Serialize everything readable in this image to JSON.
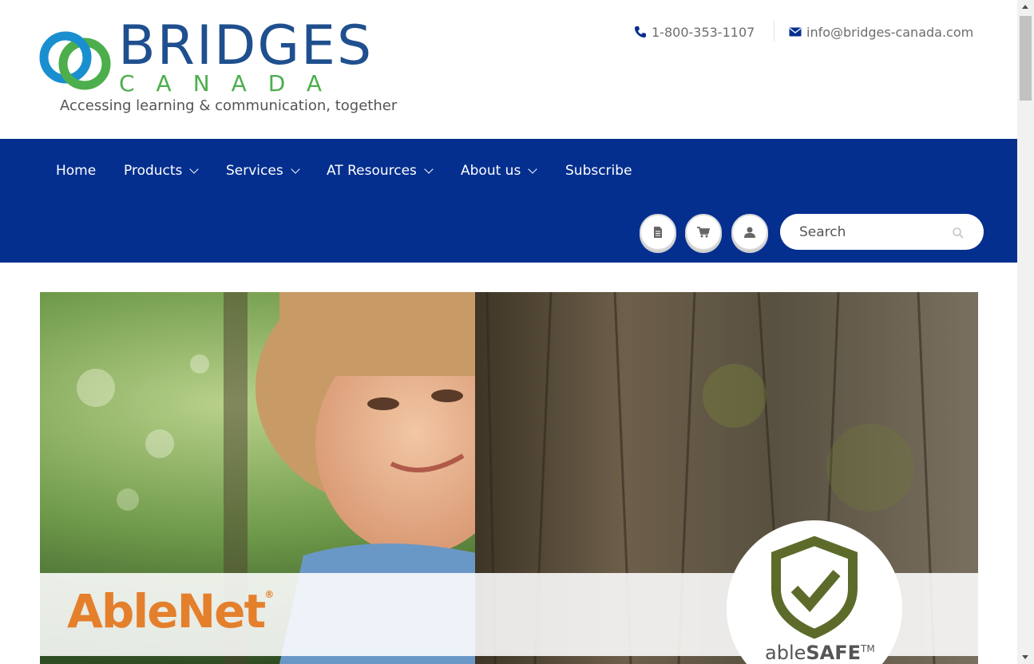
{
  "header": {
    "logo": {
      "brand": "BRIDGES",
      "sub": "CANADA",
      "tagline": "Accessing learning & communication, together",
      "colors": {
        "blue": "#1f4f8e",
        "green": "#4cae4c"
      }
    },
    "phone": {
      "icon": "phone-icon",
      "text": "1-800-353-1107"
    },
    "email": {
      "icon": "envelope-icon",
      "text": "info@bridges-canada.com"
    }
  },
  "nav": {
    "background": "#042f8f",
    "items": [
      {
        "label": "Home",
        "dropdown": false
      },
      {
        "label": "Products",
        "dropdown": true
      },
      {
        "label": "Services",
        "dropdown": true
      },
      {
        "label": "AT Resources",
        "dropdown": true
      },
      {
        "label": "About us",
        "dropdown": true
      },
      {
        "label": "Subscribe",
        "dropdown": false
      }
    ],
    "icons": [
      "document-icon",
      "cart-icon",
      "user-icon"
    ],
    "search": {
      "placeholder": "Search",
      "icon": "search-icon"
    }
  },
  "hero": {
    "brand": "AbleNet",
    "brand_mark": "®",
    "badge_prefix": "able",
    "badge_strong": "SAFE",
    "badge_mark": "TM",
    "brand_color": "#e47f2c",
    "badge_color": "#5d6b2a"
  }
}
